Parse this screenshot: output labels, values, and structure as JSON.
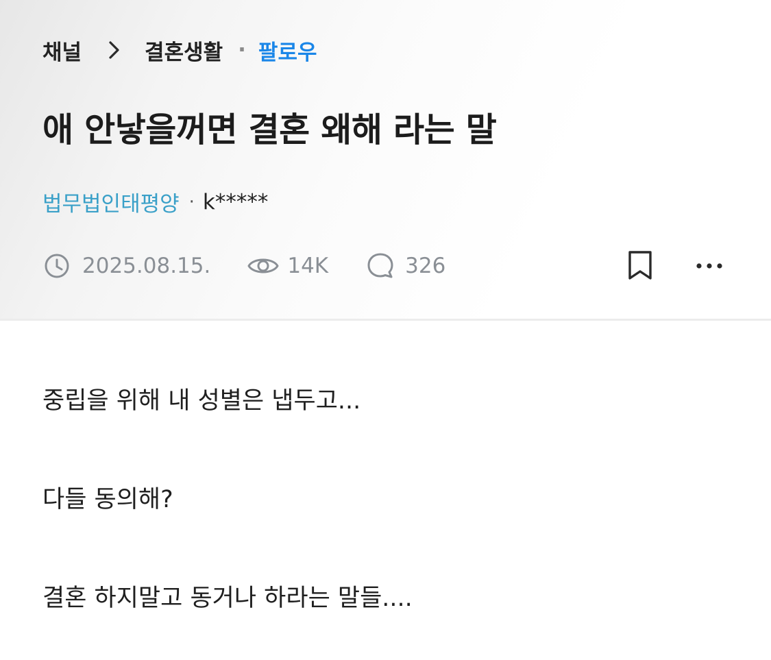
{
  "breadcrumb": {
    "root": "채널",
    "channel": "결혼생활",
    "separator": "·",
    "follow_label": "팔로우"
  },
  "post": {
    "title": "애 안낳을꺼면 결혼 왜해 라는 말",
    "author_org": "법무법인태평양",
    "author_separator": "·",
    "author_name": "k*****",
    "date": "2025.08.15.",
    "views": "14K",
    "comments": "326"
  },
  "content": {
    "paragraphs": [
      "중립을 위해 내 성별은 냅두고...",
      "다들 동의해?",
      "결혼 하지말고 동거나 하라는 말들...."
    ]
  },
  "icons": {
    "chevron": "chevron-right-icon",
    "clock": "clock-icon",
    "eye": "eye-icon",
    "comment": "comment-bubble-icon",
    "bookmark": "bookmark-icon",
    "more": "more-horizontal-icon"
  },
  "colors": {
    "follow": "#1a86e8",
    "author_org": "#3aa0c8",
    "meta_gray": "#8a8f95",
    "title": "#1c1c1c"
  }
}
